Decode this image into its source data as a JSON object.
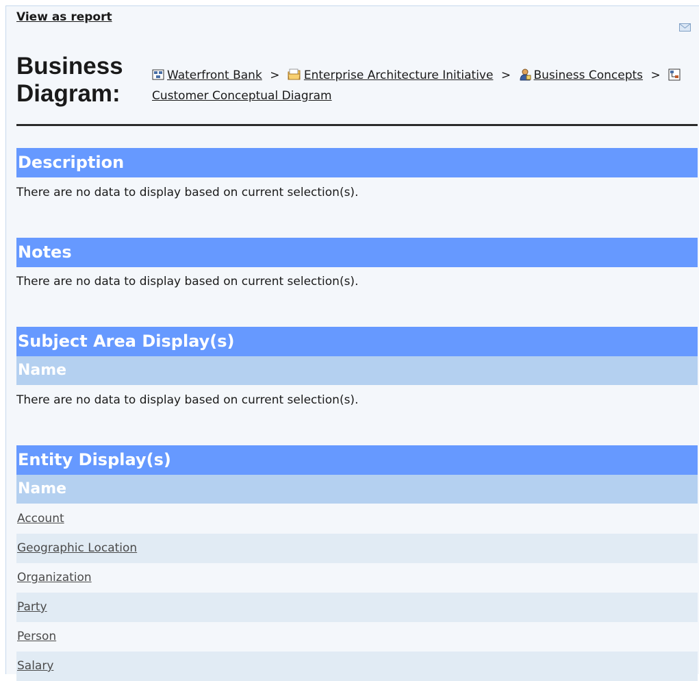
{
  "header": {
    "view_as_report": "View as report",
    "title_line1": "Business",
    "title_line2": "Diagram:",
    "mail_icon": "envelope-icon"
  },
  "breadcrumb": {
    "separator": ">",
    "items": [
      {
        "label": "Waterfront Bank",
        "icon": "model-icon"
      },
      {
        "label": "Enterprise Architecture Initiative",
        "icon": "folder-icon"
      },
      {
        "label": "Business Concepts",
        "icon": "person-icon"
      },
      {
        "label": "Customer Conceptual Diagram",
        "icon": "diagram-icon"
      }
    ]
  },
  "sections": {
    "description": {
      "title": "Description",
      "empty_text": "There are no data to display based on current selection(s)."
    },
    "notes": {
      "title": "Notes",
      "empty_text": "There are no data to display based on current selection(s)."
    },
    "subject_area": {
      "title": "Subject Area Display(s)",
      "column": "Name",
      "empty_text": "There are no data to display based on current selection(s)."
    },
    "entity": {
      "title": "Entity Display(s)",
      "column": "Name",
      "rows": [
        "Account",
        "Geographic Location",
        "Organization",
        "Party",
        "Person",
        "Salary"
      ]
    }
  },
  "colors": {
    "section_header": "#6699ff",
    "column_header": "#b4d0f0",
    "row_alt": "#e1ebf4",
    "page_background": "#f4f7fb"
  }
}
